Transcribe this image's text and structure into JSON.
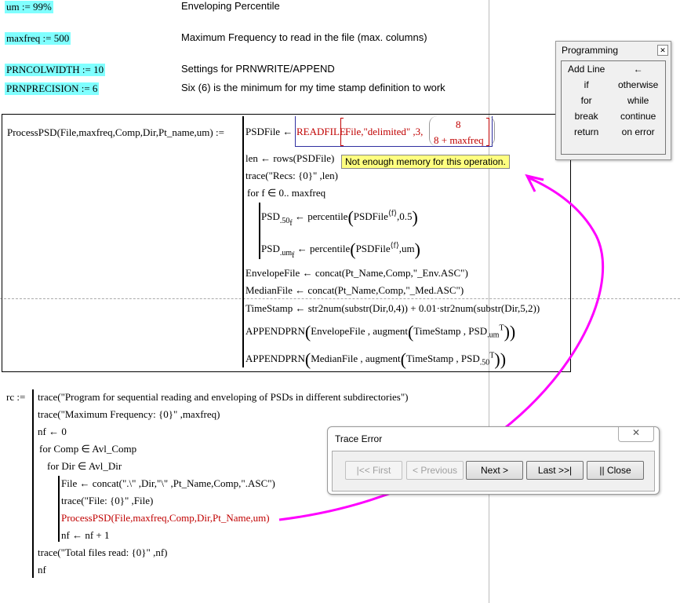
{
  "definitions": [
    {
      "expr": "um := 99%",
      "desc": "Enveloping  Percentile"
    },
    {
      "expr": "maxfreq := 500",
      "desc": "Maximum Frequency to read in the file (max. columns)"
    },
    {
      "expr": "PRNCOLWIDTH := 10",
      "desc": "Settings for PRNWRITE/APPEND"
    },
    {
      "expr": "PRNPRECISION := 6",
      "desc": "Six (6) is the minimum for my time stamp definition to work"
    }
  ],
  "process": {
    "signature": "ProcessPSD(File,maxfreq,Comp,Dir,Pt_name,um) :=",
    "readfile_lhs": "PSDFile ←",
    "readfile_fn": "READFILE",
    "readfile_args": "File,\"delimited\" ,3,",
    "readfile_top": "8",
    "readfile_bottom": "8 + maxfreq",
    "len": "len ← rows(PSDFile)",
    "trace": "trace(\"Recs: {0}\" ,len)",
    "for": "for  f  ∈ 0.. maxfreq",
    "psd50": {
      "base": "PSD",
      "sub": ".50",
      "subsub": "f",
      "rest": "← percentile",
      "arg": "PSDFile",
      "sup": "⟨f⟩",
      "tail": ",0.5"
    },
    "psdum": {
      "base": "PSD",
      "sub": ".um",
      "subsub": "f",
      "rest": "← percentile",
      "arg": "PSDFile",
      "sup": "⟨f⟩",
      "tail": ",um"
    },
    "envelope": "EnvelopeFile ← concat(Pt_Name,Comp,\"_Env.ASC\")",
    "median": "MedianFile ← concat(Pt_Name,Comp,\"_Med.ASC\")",
    "timestamp": "TimeStamp ← str2num(substr(Dir,0,4)) + 0.01·str2num(substr(Dir,5,2))",
    "append1": {
      "fn": "APPENDPRN",
      "a": "EnvelopeFile , augment",
      "b": "TimeStamp , PSD",
      "sub": ".um",
      "sup": "T"
    },
    "append2": {
      "fn": "APPENDPRN",
      "a": "MedianFile , augment",
      "b": "TimeStamp , PSD",
      "sub": ".50",
      "sup": "T"
    },
    "error_tooltip": "Not enough memory for this operation."
  },
  "rc": {
    "label": "rc :=",
    "lines": [
      "trace(\"Program for sequential reading and enveloping of PSDs in different subdirectories\")",
      "trace(\"Maximum Frequency: {0}\" ,maxfreq)",
      "nf ← 0",
      "for  Comp ∈ Avl_Comp",
      "for  Dir ∈ Avl_Dir",
      "File ← concat(\".\\\" ,Dir,\"\\\" ,Pt_Name,Comp,\".ASC\")",
      "trace(\"File: {0}\" ,File)",
      "ProcessPSD(File,maxfreq,Comp,Dir,Pt_Name,um)",
      "nf ← nf + 1",
      "trace(\"Total files read: {0}\" ,nf)",
      "nf"
    ]
  },
  "programming_palette": {
    "title": "Programming",
    "items": [
      "Add Line",
      "←",
      "if",
      "otherwise",
      "for",
      "while",
      "break",
      "continue",
      "return",
      "on error"
    ]
  },
  "trace_dialog": {
    "title": "Trace Error",
    "buttons": [
      {
        "label": "|<<  First",
        "enabled": false
      },
      {
        "label": "<  Previous",
        "enabled": false
      },
      {
        "label": "Next  >",
        "enabled": true
      },
      {
        "label": "Last  >>|",
        "enabled": true
      },
      {
        "label": "||  Close",
        "enabled": true
      }
    ]
  },
  "colors": {
    "highlight": "#80ffff",
    "error": "#c00000",
    "annotation": "#ff00ff",
    "tooltip": "#ffff80"
  }
}
